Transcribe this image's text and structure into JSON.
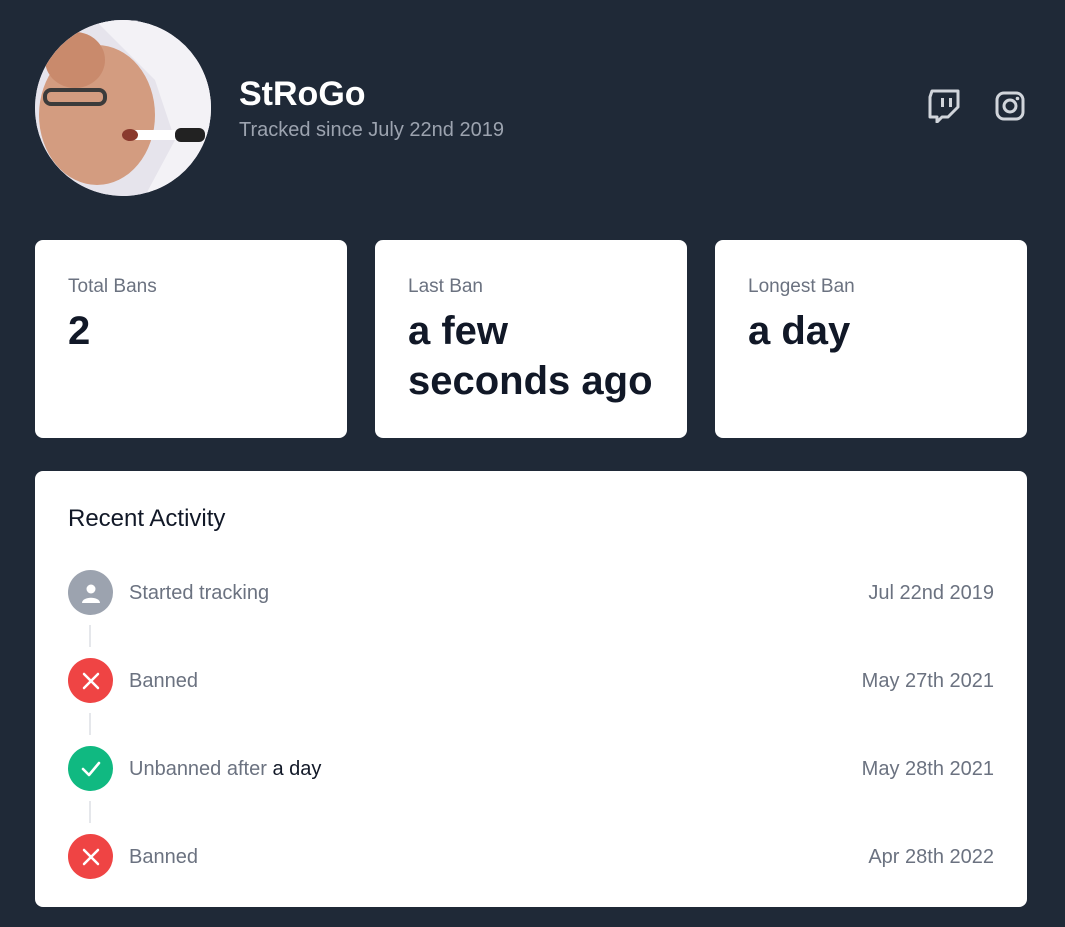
{
  "profile": {
    "username": "StRoGo",
    "tracked_since": "Tracked since July 22nd 2019",
    "avatar_icon": "user-avatar-photo"
  },
  "social": {
    "twitch_icon": "twitch-icon",
    "instagram_icon": "instagram-icon"
  },
  "stats": [
    {
      "label": "Total Bans",
      "value": "2"
    },
    {
      "label": "Last Ban",
      "value": "a few seconds ago"
    },
    {
      "label": "Longest Ban",
      "value": "a day"
    }
  ],
  "activity": {
    "title": "Recent Activity",
    "items": [
      {
        "icon": "user-icon",
        "text": "Started tracking",
        "emphasis": "",
        "date": "Jul 22nd 2019",
        "color": "#9ca3af"
      },
      {
        "icon": "x-icon",
        "text": "Banned",
        "emphasis": "",
        "date": "May 27th 2021",
        "color": "#ef4444"
      },
      {
        "icon": "check-icon",
        "text": "Unbanned after ",
        "emphasis": "a day",
        "date": "May 28th 2021",
        "color": "#10b981"
      },
      {
        "icon": "x-icon",
        "text": "Banned",
        "emphasis": "",
        "date": "Apr 28th 2022",
        "color": "#ef4444"
      }
    ]
  },
  "colors": {
    "background": "#1f2937",
    "card": "#ffffff",
    "muted_text": "#6b7280",
    "ban_red": "#ef4444",
    "unban_green": "#10b981",
    "neutral_gray": "#9ca3af"
  }
}
